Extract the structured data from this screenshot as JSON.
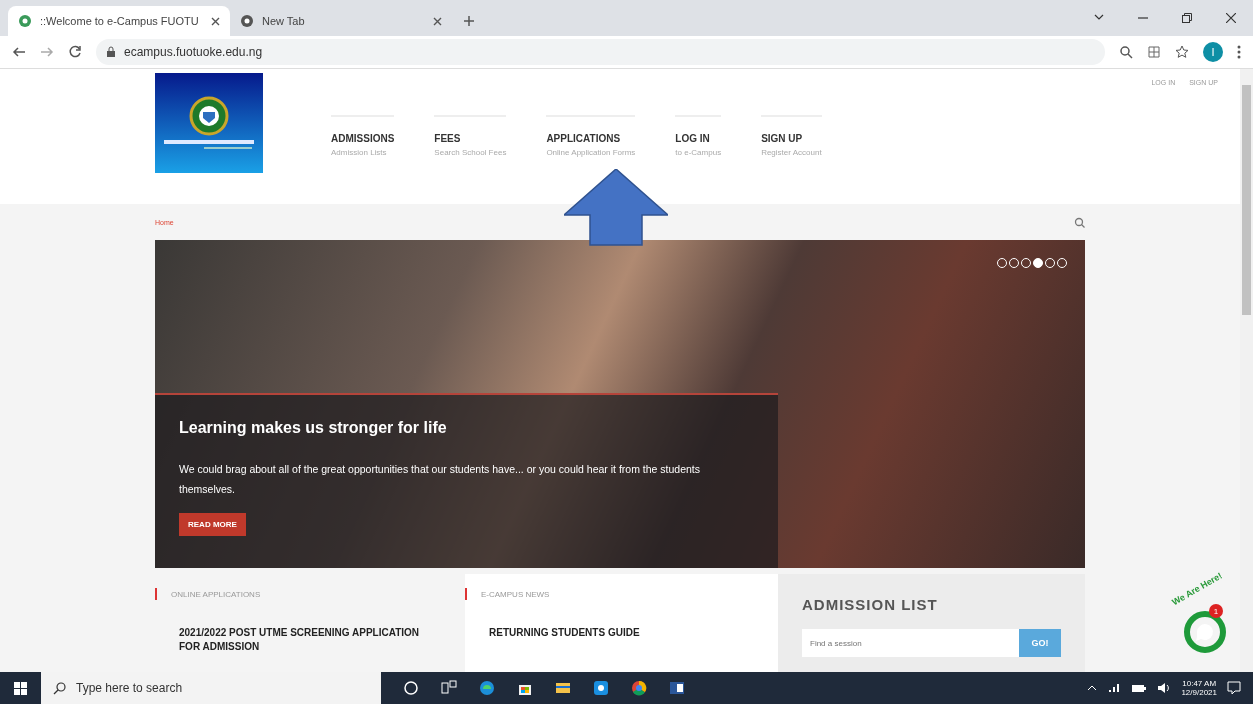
{
  "browser": {
    "tabs": [
      {
        "title": "::Welcome to e-Campus FUOTU",
        "selected": true
      },
      {
        "title": "New Tab",
        "selected": false
      }
    ],
    "address": "ecampus.fuotuoke.edu.ng",
    "profile_initial": "I"
  },
  "top_links": [
    "LOG IN",
    "SIGN UP"
  ],
  "nav": [
    {
      "title": "ADMISSIONS",
      "subtitle": "Admission Lists"
    },
    {
      "title": "FEES",
      "subtitle": "Search School Fees"
    },
    {
      "title": "APPLICATIONS",
      "subtitle": "Online Application Forms"
    },
    {
      "title": "LOG IN",
      "subtitle": "to e-Campus"
    },
    {
      "title": "SIGN UP",
      "subtitle": "Register Account"
    }
  ],
  "breadcrumb": "Home",
  "hero": {
    "heading": "Learning makes us stronger for life",
    "text": "We could brag about all of the great opportunities that our students have... or you could hear it from the students themselves.",
    "button": "READ MORE",
    "dots": [
      {
        "selected": false
      },
      {
        "selected": false
      },
      {
        "selected": false
      },
      {
        "selected": true
      },
      {
        "selected": false
      },
      {
        "selected": false
      }
    ]
  },
  "sections": [
    {
      "label": "ONLINE APPLICATIONS",
      "headline": "2021/2022 POST UTME SCREENING APPLICATION FOR ADMISSION"
    },
    {
      "label": "E-CAMPUS NEWS",
      "headline": "RETURNING STUDENTS GUIDE"
    }
  ],
  "admission_list": {
    "title": "ADMISSION LIST",
    "placeholder": "Find a session",
    "button": "GO!"
  },
  "chat": {
    "label": "We Are Here!",
    "badge": "1"
  },
  "taskbar": {
    "search_placeholder": "Type here to search",
    "time": "10:47 AM",
    "date": "12/9/2021"
  }
}
